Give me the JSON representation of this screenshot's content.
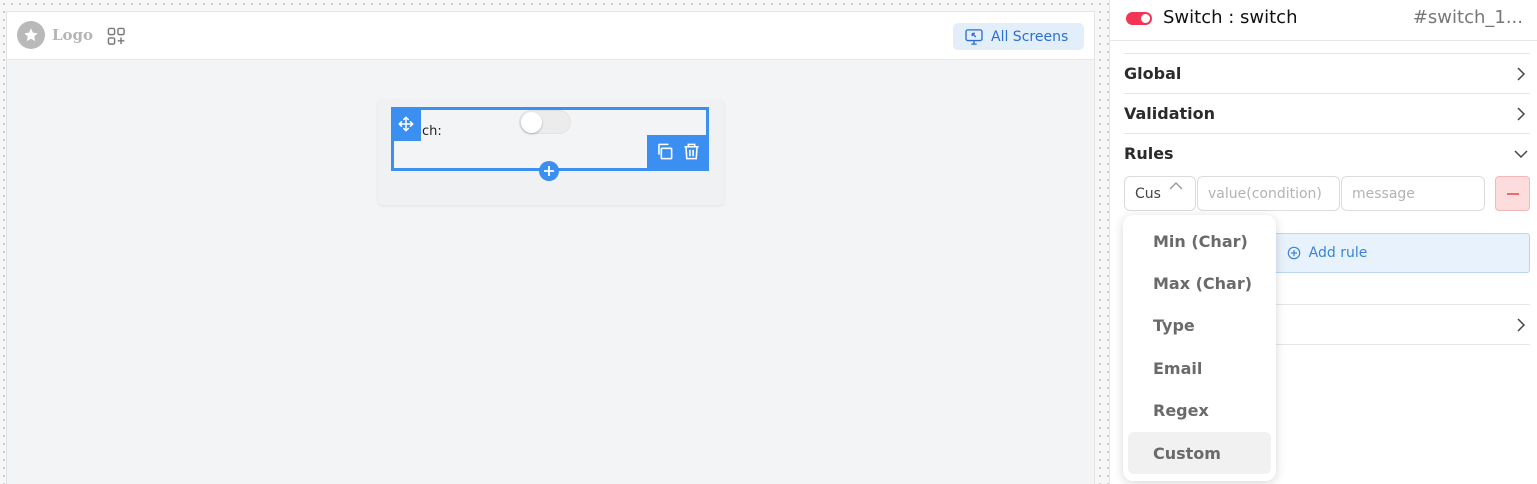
{
  "preview": {
    "logo_text": "Logo",
    "all_screens_label": "All Screens",
    "form": {
      "field_label": "ch:"
    }
  },
  "panel": {
    "component_title": "Switch : switch",
    "component_id": "#switch_1...",
    "sections": {
      "global": "Global",
      "validation": "Validation",
      "rules": "Rules"
    },
    "rule": {
      "type_value": "Cus",
      "value_placeholder": "value(condition)",
      "message_placeholder": "message"
    },
    "add_rule_label": "Add rule"
  },
  "dropdown": {
    "options": [
      "Min (Char)",
      "Max (Char)",
      "Type",
      "Email",
      "Regex",
      "Custom"
    ],
    "selected": "Custom"
  },
  "colors": {
    "accent_blue": "#3b8ff0",
    "switch_red": "#f43454",
    "remove_red": "#fcdcdc"
  },
  "icons": {
    "logo": "star-icon",
    "apps": "add-apps-icon",
    "screens": "monitor-icon",
    "move": "move-icon",
    "copy": "copy-icon",
    "delete": "trash-icon",
    "add": "plus-icon",
    "expand": "chevron-right-icon",
    "collapse": "chevron-down-icon"
  }
}
